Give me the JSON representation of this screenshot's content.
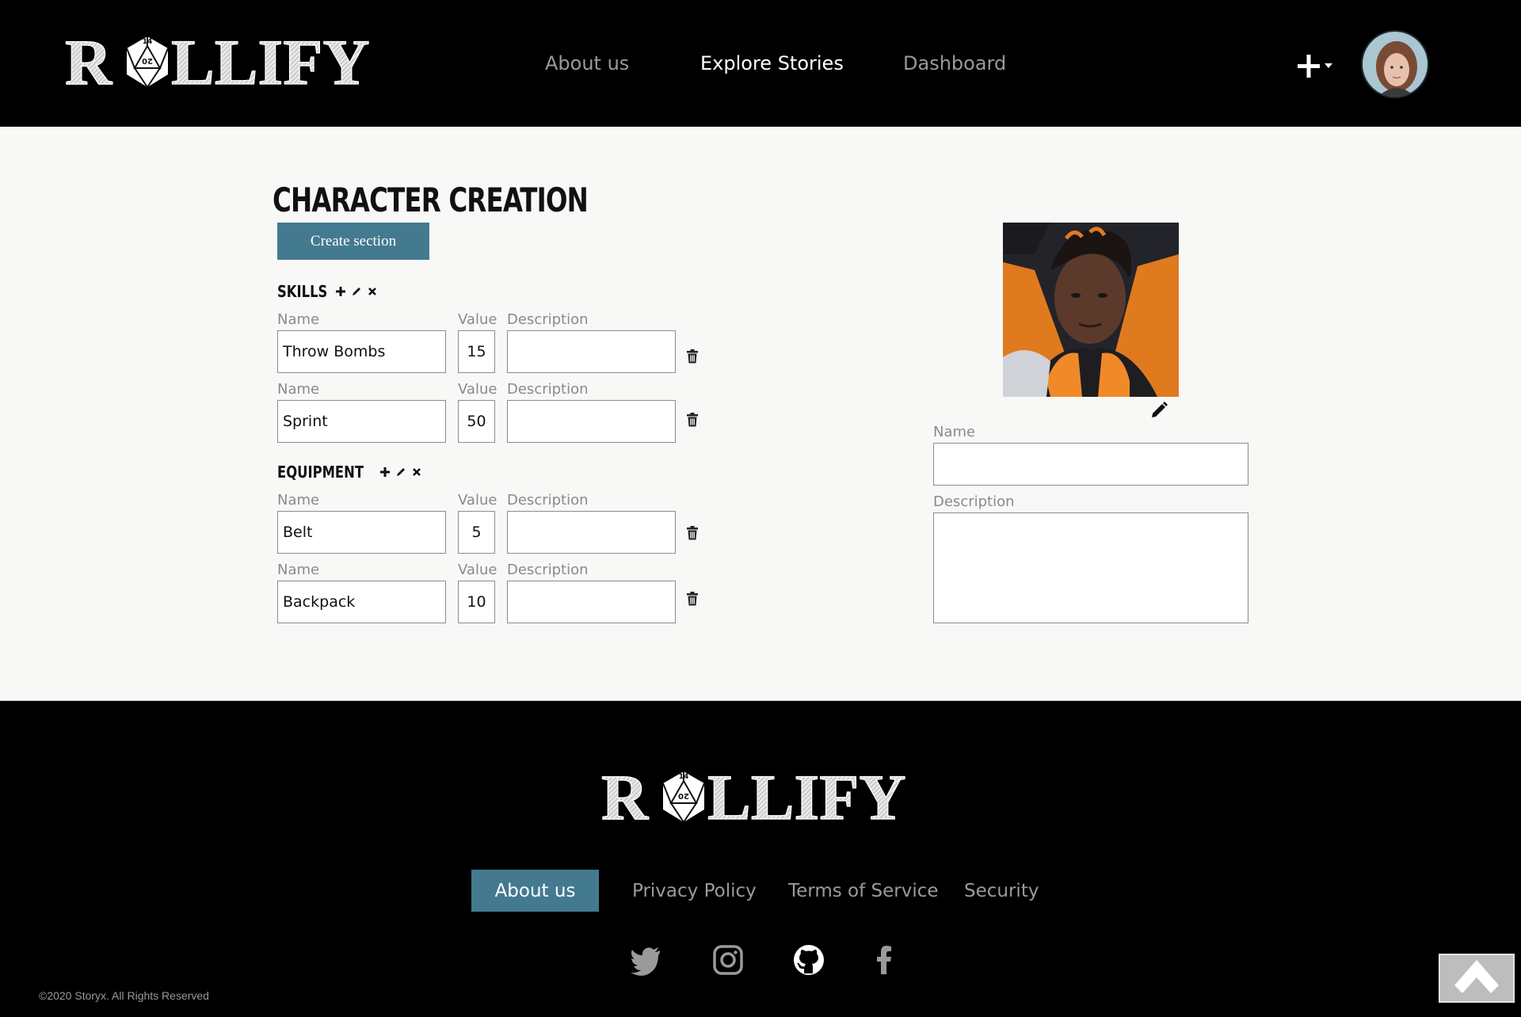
{
  "brand": {
    "logo_text": "ROLLIFY",
    "die_top": "14",
    "die_center": "20"
  },
  "nav": {
    "items": [
      {
        "label": "About us"
      },
      {
        "label": "Explore Stories"
      },
      {
        "label": "Dashboard"
      }
    ],
    "active": "Explore Stories",
    "plus_icon": "plus-dropdown-icon"
  },
  "page": {
    "title": "CHARACTER CREATION",
    "create_section_label": "Create section"
  },
  "labels": {
    "name": "Name",
    "value": "Value",
    "description": "Description"
  },
  "sections": [
    {
      "title": "SKILLS",
      "rows": [
        {
          "name": "Throw Bombs",
          "value": "15",
          "description": ""
        },
        {
          "name": "Sprint",
          "value": "50",
          "description": ""
        }
      ]
    },
    {
      "title": "EQUIPMENT",
      "rows": [
        {
          "name": "Belt",
          "value": "5",
          "description": ""
        },
        {
          "name": "Backpack",
          "value": "10",
          "description": ""
        }
      ]
    }
  ],
  "character": {
    "name_label": "Name",
    "name_value": "",
    "description_label": "Description",
    "description_value": ""
  },
  "footer": {
    "about_label": "About us",
    "links": [
      "Privacy Policy",
      "Terms of Service",
      "Security"
    ],
    "social": [
      "twitter-icon",
      "instagram-icon",
      "github-icon",
      "facebook-icon"
    ],
    "copyright": "©2020 Storyx. All Rights Reserved"
  },
  "colors": {
    "accent": "#447a8f",
    "background": "#f8f8f6",
    "header": "#000000"
  }
}
